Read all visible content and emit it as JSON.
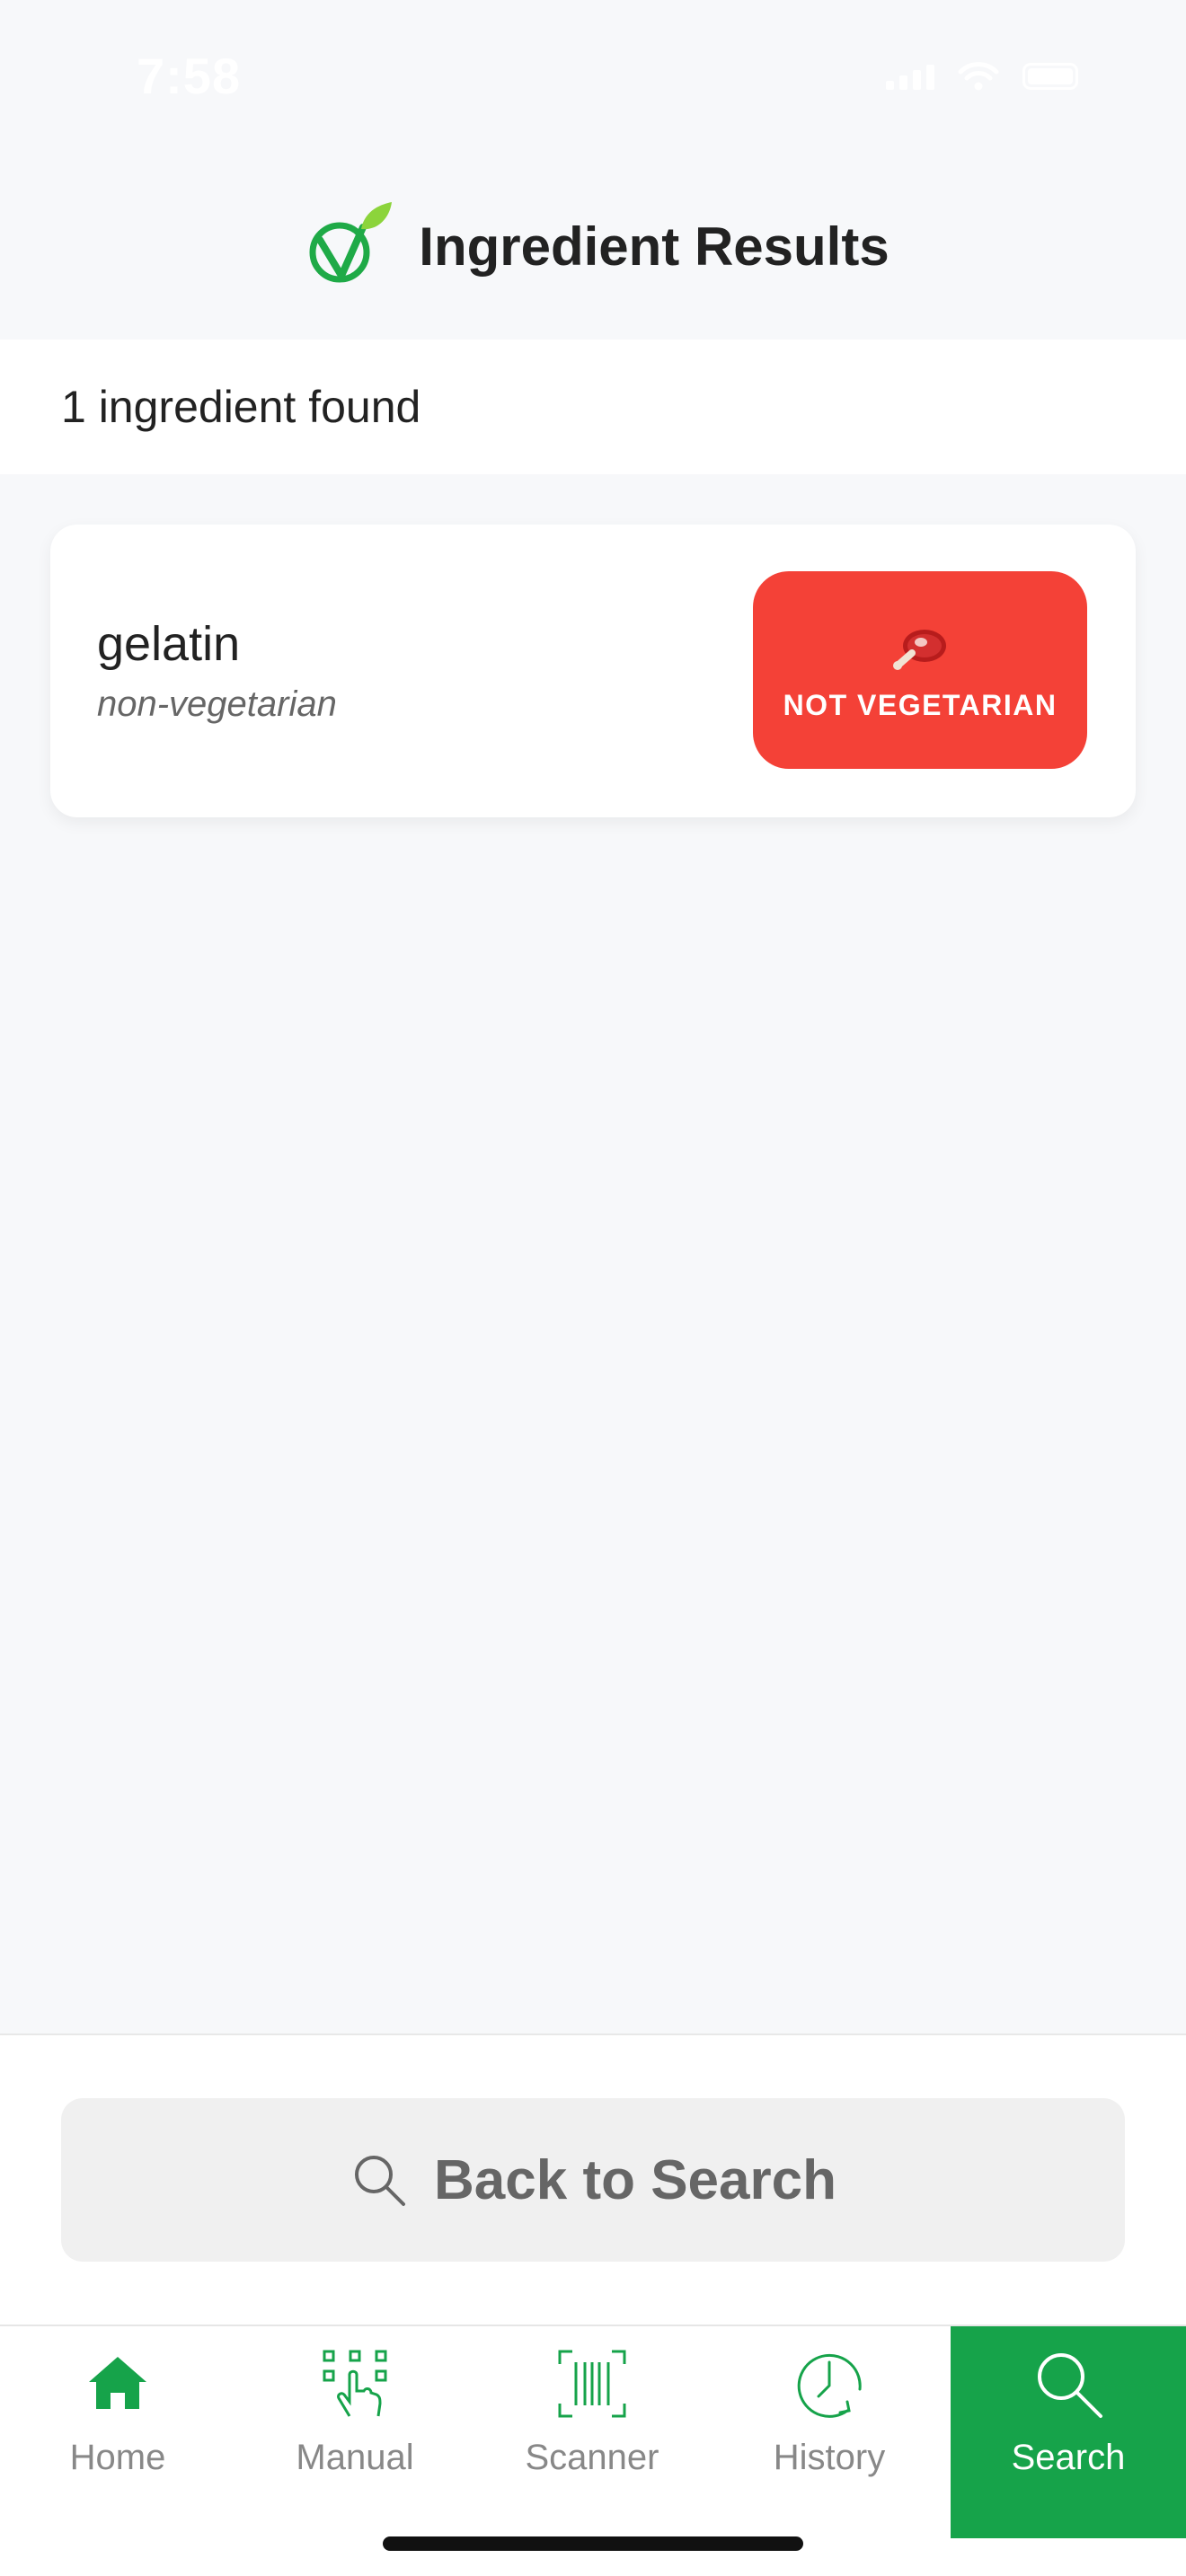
{
  "status_bar": {
    "time": "7:58"
  },
  "header": {
    "title": "Ingredient Results",
    "logo_icon": "vegetarian-logo-icon"
  },
  "results": {
    "count_text": "1 ingredient found",
    "items": [
      {
        "name": "gelatin",
        "type": "non-vegetarian",
        "status_label": "NOT VEGETARIAN",
        "status_icon": "meat-icon",
        "status_color": "#f44137"
      }
    ]
  },
  "actions": {
    "back_label": "Back to Search",
    "back_icon": "search-icon"
  },
  "tabs": [
    {
      "label": "Home",
      "icon": "home-icon",
      "active": false
    },
    {
      "label": "Manual",
      "icon": "manual-entry-icon",
      "active": false
    },
    {
      "label": "Scanner",
      "icon": "barcode-scanner-icon",
      "active": false
    },
    {
      "label": "History",
      "icon": "history-clock-icon",
      "active": false
    },
    {
      "label": "Search",
      "icon": "search-icon",
      "active": true
    }
  ],
  "colors": {
    "brand_green": "#16a34a",
    "danger_red": "#f44137",
    "background": "#f7f8fa"
  }
}
